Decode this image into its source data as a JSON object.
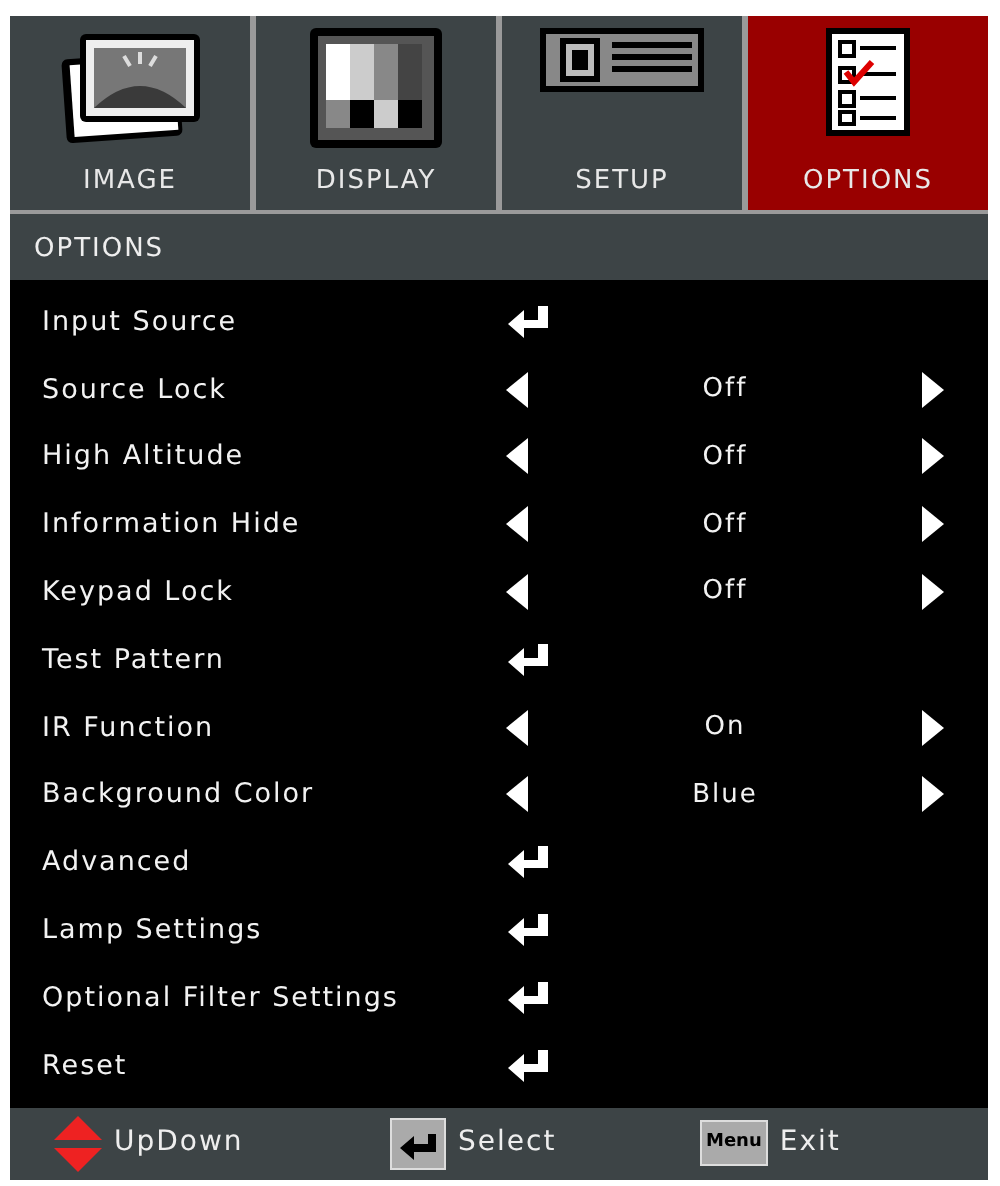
{
  "tabs": [
    {
      "label": "IMAGE",
      "kind": "image",
      "selected": false
    },
    {
      "label": "DISPLAY",
      "kind": "display",
      "selected": false
    },
    {
      "label": "SETUP",
      "kind": "setup",
      "selected": false
    },
    {
      "label": "OPTIONS",
      "kind": "options",
      "selected": true
    }
  ],
  "section_title": "OPTIONS",
  "items": [
    {
      "label": "Input Source",
      "kind": "submenu"
    },
    {
      "label": "Source Lock",
      "kind": "choice",
      "value": "Off"
    },
    {
      "label": "High Altitude",
      "kind": "choice",
      "value": "Off"
    },
    {
      "label": "Information Hide",
      "kind": "choice",
      "value": "Off"
    },
    {
      "label": "Keypad Lock",
      "kind": "choice",
      "value": "Off"
    },
    {
      "label": "Test Pattern",
      "kind": "submenu"
    },
    {
      "label": "IR Function",
      "kind": "choice",
      "value": "On"
    },
    {
      "label": "Background Color",
      "kind": "choice",
      "value": "Blue"
    },
    {
      "label": "Advanced",
      "kind": "submenu"
    },
    {
      "label": "Lamp Settings",
      "kind": "submenu"
    },
    {
      "label": "Optional Filter Settings",
      "kind": "submenu"
    },
    {
      "label": "Reset",
      "kind": "submenu"
    }
  ],
  "footer": [
    {
      "kind": "updown",
      "label": "UpDown"
    },
    {
      "kind": "enter",
      "label": "Select"
    },
    {
      "kind": "key",
      "key_label": "Menu",
      "label": "Exit"
    }
  ]
}
